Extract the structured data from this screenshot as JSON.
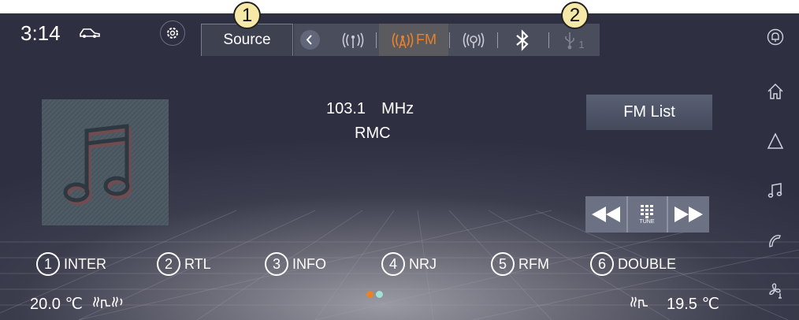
{
  "status": {
    "time": "3:14"
  },
  "callouts": {
    "first": "1",
    "second": "2"
  },
  "source": {
    "label": "Source",
    "active_band": "FM"
  },
  "now_playing": {
    "frequency": "103.1",
    "unit": "MHz",
    "station": "RMC"
  },
  "fm_list_label": "FM List",
  "tune_label": "TUNE",
  "usb_index": "1",
  "presets": [
    {
      "num": "1",
      "name": "INTER"
    },
    {
      "num": "2",
      "name": "RTL"
    },
    {
      "num": "3",
      "name": "INFO"
    },
    {
      "num": "4",
      "name": "NRJ"
    },
    {
      "num": "5",
      "name": "RFM"
    },
    {
      "num": "6",
      "name": "DOUBLE"
    }
  ],
  "climate": {
    "left_temp": "20.0 ℃",
    "right_temp": "19.5 ℃"
  },
  "page_dots": {
    "count": 2,
    "active": 1
  },
  "colors": {
    "accent": "#e8822a",
    "callout": "#f6e8a6",
    "background": "#2e3042"
  },
  "icons": [
    "car-icon",
    "settings-icon",
    "back-chevron-icon",
    "am-radio-icon",
    "fm-radio-icon",
    "dab-radio-icon",
    "bluetooth-icon",
    "usb-icon",
    "bell-icon",
    "home-icon",
    "navigation-icon",
    "music-icon",
    "phone-icon",
    "fan-icon",
    "seat-heat-icon",
    "music-note-icon",
    "rewind-icon",
    "keypad-icon",
    "fast-forward-icon"
  ]
}
